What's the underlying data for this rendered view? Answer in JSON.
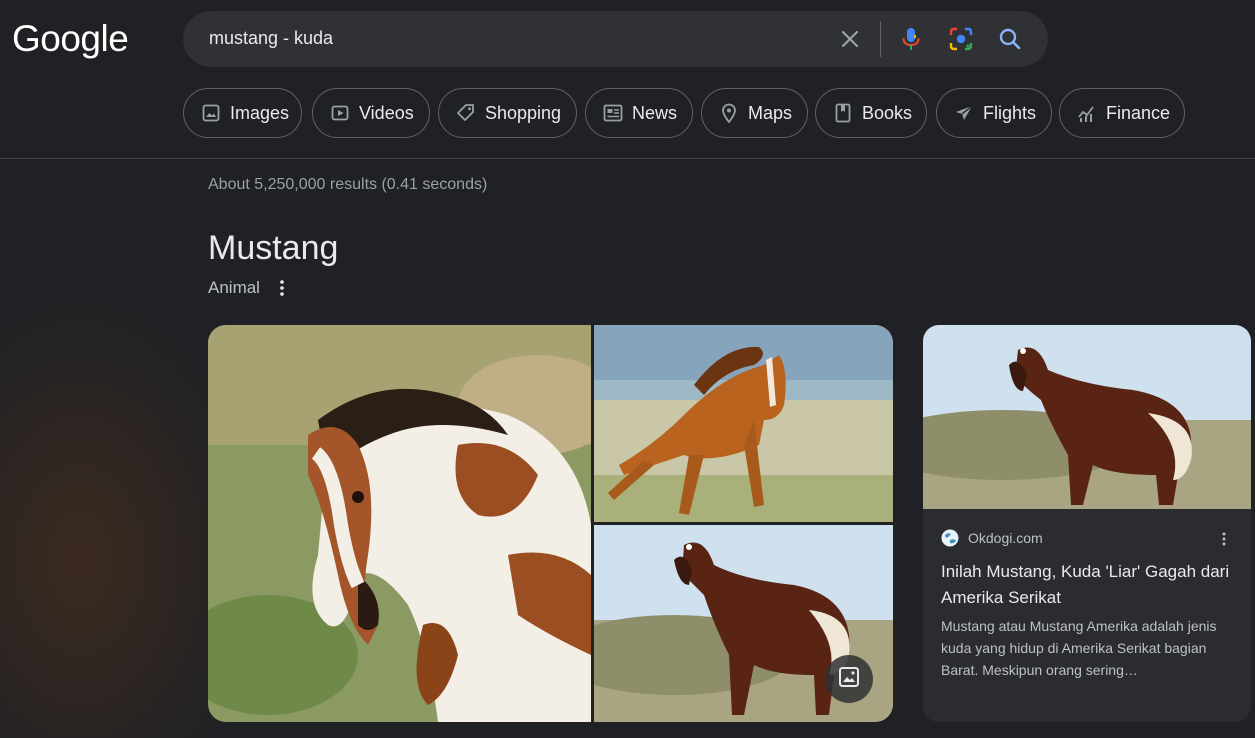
{
  "logo": "Google",
  "search": {
    "query": "mustang - kuda",
    "icons": [
      "close-icon",
      "mic-icon",
      "lens-icon",
      "search-icon"
    ]
  },
  "chips": [
    {
      "label": "Images",
      "icon": "image-icon"
    },
    {
      "label": "Videos",
      "icon": "video-icon"
    },
    {
      "label": "Shopping",
      "icon": "tag-icon"
    },
    {
      "label": "News",
      "icon": "news-icon"
    },
    {
      "label": "Maps",
      "icon": "pin-icon"
    },
    {
      "label": "Books",
      "icon": "book-icon"
    },
    {
      "label": "Flights",
      "icon": "plane-icon"
    },
    {
      "label": "Finance",
      "icon": "chart-icon"
    }
  ],
  "stats": "About 5,250,000 results (0.41 seconds)",
  "knowledge_panel": {
    "title": "Mustang",
    "subtitle": "Animal"
  },
  "result_card": {
    "source": "Okdogi.com",
    "title": "Inilah Mustang, Kuda 'Liar' Gagah dari Amerika Serikat",
    "snippet": "Mustang atau Mustang Amerika adalah jenis kuda yang hidup di Amerika Serikat bagian Barat. Meskipun orang sering…"
  },
  "colors": {
    "background": "#202124",
    "searchbar": "#303134",
    "border": "#5f6368",
    "text": "#e8eaed",
    "muted": "#9aa0a6"
  }
}
